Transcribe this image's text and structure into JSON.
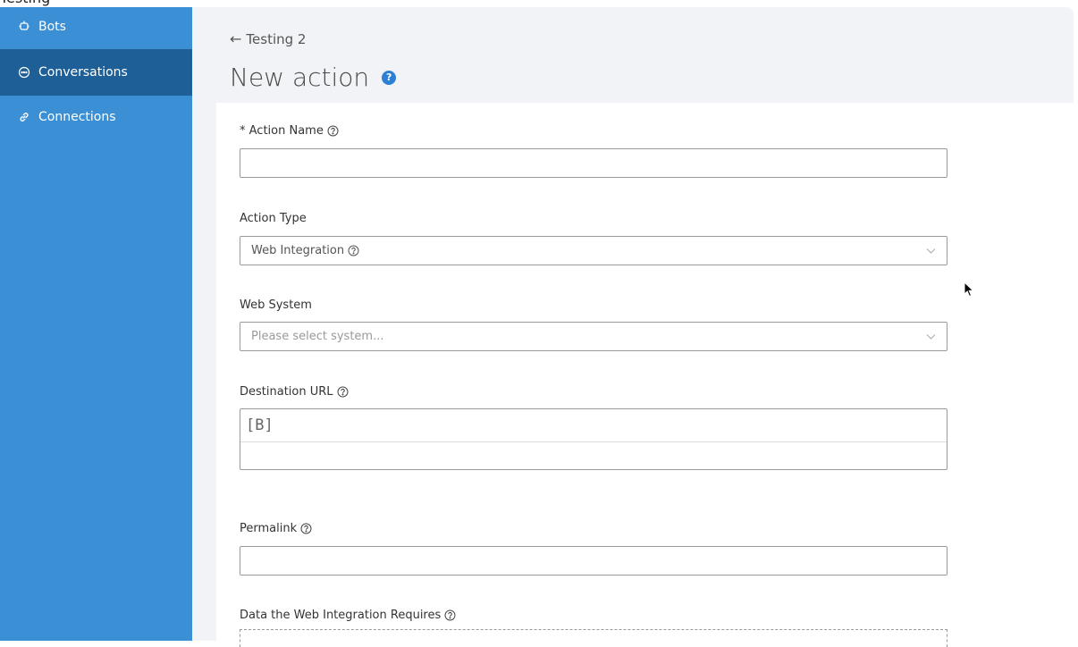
{
  "window": {
    "clipped_title": "Testing"
  },
  "sidebar": {
    "items": [
      {
        "label": "Bots",
        "icon": "bot-icon"
      },
      {
        "label": "Conversations",
        "icon": "chat-icon"
      },
      {
        "label": "Connections",
        "icon": "link-icon"
      }
    ],
    "active_index": 1
  },
  "header": {
    "back_label": "Testing 2",
    "title": "New action"
  },
  "form": {
    "action_name": {
      "label": "* Action Name",
      "value": ""
    },
    "action_type": {
      "label": "Action Type",
      "value": "Web Integration"
    },
    "web_system": {
      "label": "Web System",
      "placeholder": "Please select system..."
    },
    "destination_url": {
      "label": "Destination URL",
      "value": "[B]"
    },
    "permalink": {
      "label": "Permalink",
      "value": ""
    },
    "data_required": {
      "label": "Data the Web Integration Requires"
    }
  },
  "colors": {
    "sidebar": "#3a8fd5",
    "sidebar_active": "#1e5f97",
    "accent": "#2d7fd3",
    "main_bg": "#f2f3f6"
  }
}
